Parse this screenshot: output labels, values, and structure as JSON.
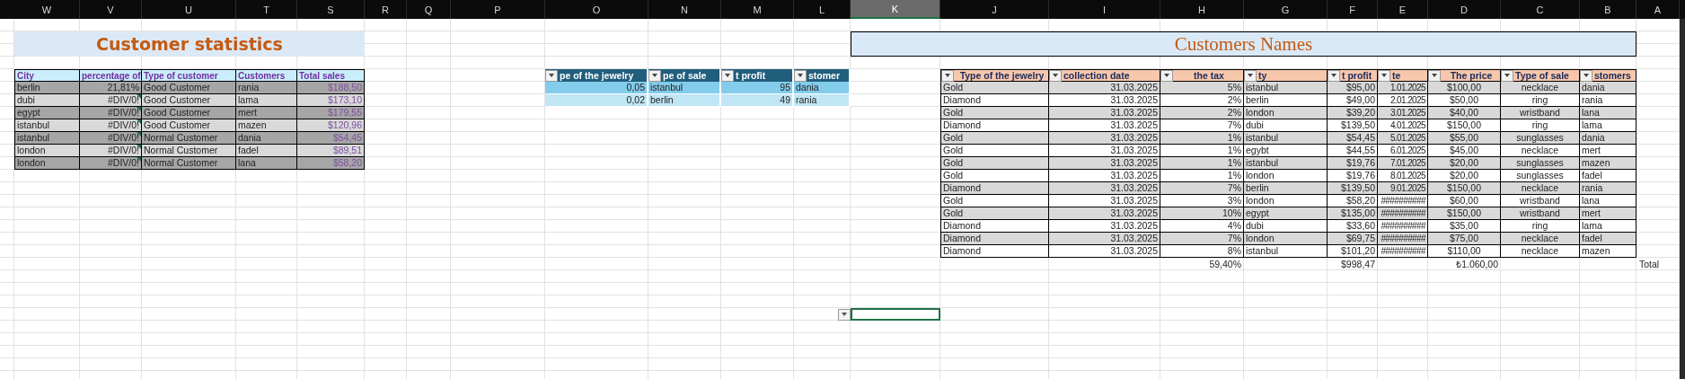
{
  "column_headers": [
    {
      "label": "W",
      "selected": false
    },
    {
      "label": "V",
      "selected": false
    },
    {
      "label": "U",
      "selected": false
    },
    {
      "label": "T",
      "selected": false
    },
    {
      "label": "S",
      "selected": false
    },
    {
      "label": "R",
      "selected": false
    },
    {
      "label": "Q",
      "selected": false
    },
    {
      "label": "P",
      "selected": false
    },
    {
      "label": "O",
      "selected": false
    },
    {
      "label": "N",
      "selected": false
    },
    {
      "label": "M",
      "selected": false
    },
    {
      "label": "L",
      "selected": false
    },
    {
      "label": "K",
      "selected": true
    },
    {
      "label": "J",
      "selected": false
    },
    {
      "label": "I",
      "selected": false
    },
    {
      "label": "H",
      "selected": false
    },
    {
      "label": "G",
      "selected": false
    },
    {
      "label": "F",
      "selected": false
    },
    {
      "label": "E",
      "selected": false
    },
    {
      "label": "D",
      "selected": false
    },
    {
      "label": "C",
      "selected": false
    },
    {
      "label": "B",
      "selected": false
    },
    {
      "label": "A",
      "selected": false
    }
  ],
  "customer_statistics": {
    "title": "Customer statistics",
    "columns": [
      "City",
      "percentage of",
      "Type of customer",
      "Customers",
      "Total sales"
    ],
    "rows": [
      {
        "cells": [
          "berlin",
          "21,81%",
          "Good Customer",
          "rania",
          "$188,50"
        ],
        "flagged": false
      },
      {
        "cells": [
          "dubi",
          "#DIV/0!",
          "Good Customer",
          "lama",
          "$173,10"
        ],
        "flagged": true
      },
      {
        "cells": [
          "egypt",
          "#DIV/0!",
          "Good Customer",
          "mert",
          "$179,55"
        ],
        "flagged": true
      },
      {
        "cells": [
          "istanbul",
          "#DIV/0!",
          "Good Customer",
          "mazen",
          "$120,96"
        ],
        "flagged": true
      },
      {
        "cells": [
          "istanbul",
          "#DIV/0!",
          "Normal Customer",
          "dania",
          "$54,45"
        ],
        "flagged": true
      },
      {
        "cells": [
          "london",
          "#DIV/0!",
          "Normal Customer",
          "fadel",
          "$89,51"
        ],
        "flagged": true
      },
      {
        "cells": [
          "london",
          "#DIV/0!",
          "Normal Customer",
          "lana",
          "$58,20"
        ],
        "flagged": true
      }
    ]
  },
  "filter_table": {
    "columns": [
      "pe of the jewelry",
      "pe of sale",
      "t profit",
      "stomer"
    ],
    "rows": [
      [
        "0,05",
        "istanbul",
        "95",
        "dania"
      ],
      [
        "0,02",
        "berlin",
        "49",
        "rania"
      ]
    ]
  },
  "customers_names": {
    "title": "Customers Names",
    "columns": [
      "Type of the jewelry",
      "collection date",
      "the tax",
      "ty",
      "t profit",
      "te",
      "The price",
      "Type of sale",
      "stomers"
    ],
    "rows": [
      [
        "Gold",
        "31.03.2025",
        "5%",
        "istanbul",
        "$95,00",
        "1.01.2025",
        "$100,00",
        "necklace",
        "dania"
      ],
      [
        "Diamond",
        "31.03.2025",
        "2%",
        "berlin",
        "$49,00",
        "2.01.2025",
        "$50,00",
        "ring",
        "rania"
      ],
      [
        "Gold",
        "31.03.2025",
        "2%",
        "london",
        "$39,20",
        "3.01.2025",
        "$40,00",
        "wristband",
        "lana"
      ],
      [
        "Diamond",
        "31.03.2025",
        "7%",
        "dubi",
        "$139,50",
        "4.01.2025",
        "$150,00",
        "ring",
        "lama"
      ],
      [
        "Gold",
        "31.03.2025",
        "1%",
        "istanbul",
        "$54,45",
        "5.01.2025",
        "$55,00",
        "sunglasses",
        "dania"
      ],
      [
        "Gold",
        "31.03.2025",
        "1%",
        "egybt",
        "$44,55",
        "6.01.2025",
        "$45,00",
        "necklace",
        "mert"
      ],
      [
        "Gold",
        "31.03.2025",
        "1%",
        "istanbul",
        "$19,76",
        "7.01.2025",
        "$20,00",
        "sunglasses",
        "mazen"
      ],
      [
        "Gold",
        "31.03.2025",
        "1%",
        "london",
        "$19,76",
        "8.01.2025",
        "$20,00",
        "sunglasses",
        "fadel"
      ],
      [
        "Diamond",
        "31.03.2025",
        "7%",
        "berlin",
        "$139,50",
        "9.01.2025",
        "$150,00",
        "necklace",
        "rania"
      ],
      [
        "Gold",
        "31.03.2025",
        "3%",
        "london",
        "$58,20",
        "##########",
        "$60,00",
        "wristband",
        "lana"
      ],
      [
        "Gold",
        "31.03.2025",
        "10%",
        "egypt",
        "$135,00",
        "##########",
        "$150,00",
        "wristband",
        "mert"
      ],
      [
        "Diamond",
        "31.03.2025",
        "4%",
        "dubi",
        "$33,60",
        "##########",
        "$35,00",
        "ring",
        "lama"
      ],
      [
        "Diamond",
        "31.03.2025",
        "7%",
        "london",
        "$69,75",
        "##########",
        "$75,00",
        "necklace",
        "fadel"
      ],
      [
        "Diamond",
        "31.03.2025",
        "8%",
        "istanbul",
        "$101,20",
        "##########",
        "$110,00",
        "necklace",
        "mazen"
      ]
    ],
    "totals": {
      "tax": "59,40%",
      "profit": "$998,47",
      "price": "₺1.060,00",
      "label": "Total"
    }
  }
}
